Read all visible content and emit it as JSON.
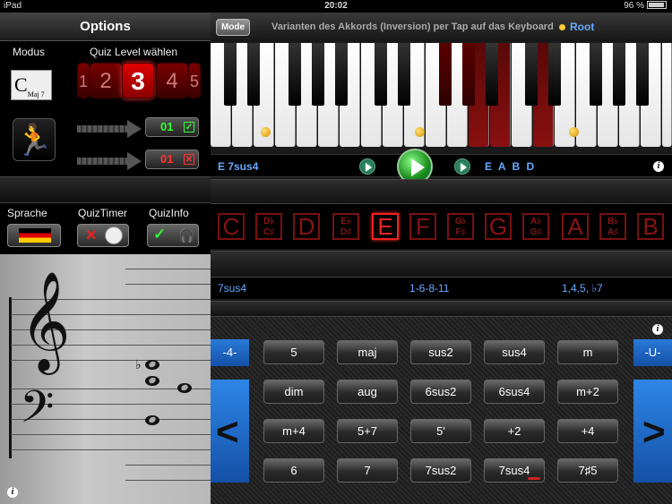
{
  "status": {
    "device": "iPad",
    "time": "20:02",
    "battery": "96 %"
  },
  "left": {
    "title": "Options",
    "modus_label": "Modus",
    "modus_symbol": "C",
    "modus_sub": "Maj 7",
    "level_label": "Quiz Level wählen",
    "levels": [
      "1",
      "2",
      "3",
      "4",
      "5"
    ],
    "active_level": "3",
    "correct_count": "01",
    "wrong_count": "01",
    "sprache_label": "Sprache",
    "timer_label": "QuizTimer",
    "info_label": "QuizInfo"
  },
  "top": {
    "mode_button": "Mode",
    "hint": "Varianten des Akkords (Inversion) per Tap auf das Keyboard",
    "root_legend": "Root"
  },
  "chord": {
    "name": "E 7sus4",
    "notes": "E A B D"
  },
  "note_names": [
    "C",
    "D♭ C♯",
    "D",
    "E♭ D♯",
    "E",
    "F",
    "G♭ F♯",
    "G",
    "A♭ G♯",
    "A",
    "B♭ A♯",
    "B"
  ],
  "active_note": "E",
  "intervals": {
    "type": "7sus4",
    "semitones": "1-6-8-11",
    "degrees": "1,4,5, ♭7"
  },
  "chord_buttons": [
    [
      "5",
      "maj",
      "sus2",
      "sus4",
      "m"
    ],
    [
      "dim",
      "aug",
      "6sus2",
      "6sus4",
      "m+2"
    ],
    [
      "m+4",
      "5+7",
      "5'",
      "+2",
      "+4"
    ],
    [
      "6",
      "7",
      "7sus2",
      "7sus4",
      "7♯5"
    ]
  ],
  "shift": {
    "down": "-4-",
    "up": "-U-"
  },
  "nav": {
    "prev": "<",
    "next": ">"
  },
  "info_glyph": "i",
  "staff": {
    "flat_glyph": "♭"
  },
  "colors": {
    "accent_blue": "#66aaff",
    "active_red": "#e22222",
    "root_gold": "#ffcc33",
    "play_green": "#1a8a1a"
  }
}
